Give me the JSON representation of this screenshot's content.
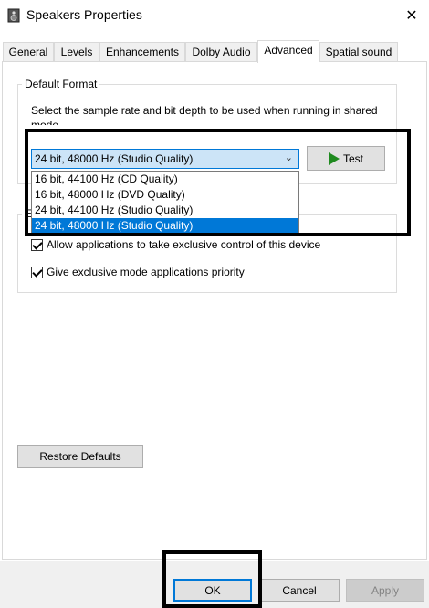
{
  "window": {
    "title": "Speakers Properties",
    "close_glyph": "✕"
  },
  "tabs": [
    {
      "label": "General",
      "active": false
    },
    {
      "label": "Levels",
      "active": false
    },
    {
      "label": "Enhancements",
      "active": false
    },
    {
      "label": "Dolby Audio",
      "active": false
    },
    {
      "label": "Advanced",
      "active": true
    },
    {
      "label": "Spatial sound",
      "active": false
    }
  ],
  "default_format": {
    "group_title": "Default Format",
    "description": "Select the sample rate and bit depth to be used when running in shared mode.",
    "selected_value": "24 bit, 48000 Hz (Studio Quality)",
    "options": [
      "16 bit, 44100 Hz (CD Quality)",
      "16 bit, 48000 Hz (DVD Quality)",
      "24 bit, 44100 Hz (Studio Quality)",
      "24 bit, 48000 Hz (Studio Quality)"
    ],
    "selected_index": 3,
    "test_label": "Test"
  },
  "exclusive_mode": {
    "group_title_partial": "E",
    "allow_exclusive_label": "Allow applications to take exclusive control of this device",
    "allow_exclusive_checked": true,
    "priority_label": "Give exclusive mode applications priority",
    "priority_checked": true
  },
  "restore_defaults_label": "Restore Defaults",
  "footer": {
    "ok_label": "OK",
    "cancel_label": "Cancel",
    "apply_label": "Apply"
  },
  "colors": {
    "accent": "#0078d7",
    "combo_highlight": "#cce4f7",
    "play_icon": "#1f8a1f"
  }
}
